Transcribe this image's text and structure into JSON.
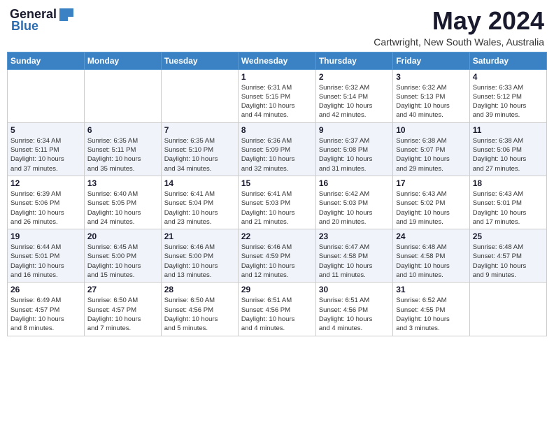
{
  "header": {
    "logo_general": "General",
    "logo_blue": "Blue",
    "month_title": "May 2024",
    "location": "Cartwright, New South Wales, Australia"
  },
  "days_of_week": [
    "Sunday",
    "Monday",
    "Tuesday",
    "Wednesday",
    "Thursday",
    "Friday",
    "Saturday"
  ],
  "weeks": [
    [
      {
        "day": "",
        "info": ""
      },
      {
        "day": "",
        "info": ""
      },
      {
        "day": "",
        "info": ""
      },
      {
        "day": "1",
        "info": "Sunrise: 6:31 AM\nSunset: 5:15 PM\nDaylight: 10 hours\nand 44 minutes."
      },
      {
        "day": "2",
        "info": "Sunrise: 6:32 AM\nSunset: 5:14 PM\nDaylight: 10 hours\nand 42 minutes."
      },
      {
        "day": "3",
        "info": "Sunrise: 6:32 AM\nSunset: 5:13 PM\nDaylight: 10 hours\nand 40 minutes."
      },
      {
        "day": "4",
        "info": "Sunrise: 6:33 AM\nSunset: 5:12 PM\nDaylight: 10 hours\nand 39 minutes."
      }
    ],
    [
      {
        "day": "5",
        "info": "Sunrise: 6:34 AM\nSunset: 5:11 PM\nDaylight: 10 hours\nand 37 minutes."
      },
      {
        "day": "6",
        "info": "Sunrise: 6:35 AM\nSunset: 5:11 PM\nDaylight: 10 hours\nand 35 minutes."
      },
      {
        "day": "7",
        "info": "Sunrise: 6:35 AM\nSunset: 5:10 PM\nDaylight: 10 hours\nand 34 minutes."
      },
      {
        "day": "8",
        "info": "Sunrise: 6:36 AM\nSunset: 5:09 PM\nDaylight: 10 hours\nand 32 minutes."
      },
      {
        "day": "9",
        "info": "Sunrise: 6:37 AM\nSunset: 5:08 PM\nDaylight: 10 hours\nand 31 minutes."
      },
      {
        "day": "10",
        "info": "Sunrise: 6:38 AM\nSunset: 5:07 PM\nDaylight: 10 hours\nand 29 minutes."
      },
      {
        "day": "11",
        "info": "Sunrise: 6:38 AM\nSunset: 5:06 PM\nDaylight: 10 hours\nand 27 minutes."
      }
    ],
    [
      {
        "day": "12",
        "info": "Sunrise: 6:39 AM\nSunset: 5:06 PM\nDaylight: 10 hours\nand 26 minutes."
      },
      {
        "day": "13",
        "info": "Sunrise: 6:40 AM\nSunset: 5:05 PM\nDaylight: 10 hours\nand 24 minutes."
      },
      {
        "day": "14",
        "info": "Sunrise: 6:41 AM\nSunset: 5:04 PM\nDaylight: 10 hours\nand 23 minutes."
      },
      {
        "day": "15",
        "info": "Sunrise: 6:41 AM\nSunset: 5:03 PM\nDaylight: 10 hours\nand 21 minutes."
      },
      {
        "day": "16",
        "info": "Sunrise: 6:42 AM\nSunset: 5:03 PM\nDaylight: 10 hours\nand 20 minutes."
      },
      {
        "day": "17",
        "info": "Sunrise: 6:43 AM\nSunset: 5:02 PM\nDaylight: 10 hours\nand 19 minutes."
      },
      {
        "day": "18",
        "info": "Sunrise: 6:43 AM\nSunset: 5:01 PM\nDaylight: 10 hours\nand 17 minutes."
      }
    ],
    [
      {
        "day": "19",
        "info": "Sunrise: 6:44 AM\nSunset: 5:01 PM\nDaylight: 10 hours\nand 16 minutes."
      },
      {
        "day": "20",
        "info": "Sunrise: 6:45 AM\nSunset: 5:00 PM\nDaylight: 10 hours\nand 15 minutes."
      },
      {
        "day": "21",
        "info": "Sunrise: 6:46 AM\nSunset: 5:00 PM\nDaylight: 10 hours\nand 13 minutes."
      },
      {
        "day": "22",
        "info": "Sunrise: 6:46 AM\nSunset: 4:59 PM\nDaylight: 10 hours\nand 12 minutes."
      },
      {
        "day": "23",
        "info": "Sunrise: 6:47 AM\nSunset: 4:58 PM\nDaylight: 10 hours\nand 11 minutes."
      },
      {
        "day": "24",
        "info": "Sunrise: 6:48 AM\nSunset: 4:58 PM\nDaylight: 10 hours\nand 10 minutes."
      },
      {
        "day": "25",
        "info": "Sunrise: 6:48 AM\nSunset: 4:57 PM\nDaylight: 10 hours\nand 9 minutes."
      }
    ],
    [
      {
        "day": "26",
        "info": "Sunrise: 6:49 AM\nSunset: 4:57 PM\nDaylight: 10 hours\nand 8 minutes."
      },
      {
        "day": "27",
        "info": "Sunrise: 6:50 AM\nSunset: 4:57 PM\nDaylight: 10 hours\nand 7 minutes."
      },
      {
        "day": "28",
        "info": "Sunrise: 6:50 AM\nSunset: 4:56 PM\nDaylight: 10 hours\nand 5 minutes."
      },
      {
        "day": "29",
        "info": "Sunrise: 6:51 AM\nSunset: 4:56 PM\nDaylight: 10 hours\nand 4 minutes."
      },
      {
        "day": "30",
        "info": "Sunrise: 6:51 AM\nSunset: 4:56 PM\nDaylight: 10 hours\nand 4 minutes."
      },
      {
        "day": "31",
        "info": "Sunrise: 6:52 AM\nSunset: 4:55 PM\nDaylight: 10 hours\nand 3 minutes."
      },
      {
        "day": "",
        "info": ""
      }
    ]
  ]
}
